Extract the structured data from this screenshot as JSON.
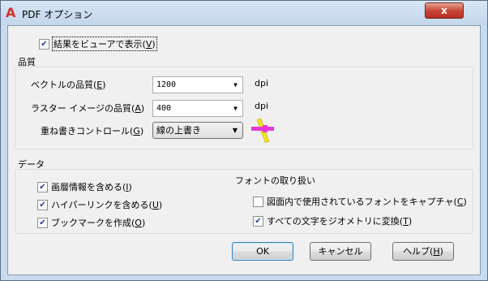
{
  "window": {
    "title": "PDF オプション",
    "app_icon": "autocad-a-icon",
    "close_label": "x"
  },
  "view_result": {
    "label": "結果をビューアで表示(",
    "key": "V",
    "suffix": ")",
    "checked": true
  },
  "quality": {
    "heading": "品質",
    "vector": {
      "label": "ベクトルの品質(",
      "key": "E",
      "suffix": ")",
      "value": "1200",
      "unit": "dpi"
    },
    "raster": {
      "label": "ラスター イメージの品質(",
      "key": "A",
      "suffix": ")",
      "value": "400",
      "unit": "dpi"
    },
    "overlay": {
      "label": "重ね書きコントロール(",
      "key": "G",
      "suffix": ")",
      "value": "線の上書き",
      "icon": "line-overwrite-icon"
    }
  },
  "data_section": {
    "heading": "データ",
    "layers": {
      "label": "画層情報を含める(",
      "key": "I",
      "suffix": ")",
      "checked": true
    },
    "hyperlinks": {
      "label": "ハイパーリンクを含める(",
      "key": "U",
      "suffix": ")",
      "checked": true
    },
    "bookmarks": {
      "label": "ブックマークを作成(",
      "key": "O",
      "suffix": ")",
      "checked": true
    }
  },
  "fonts": {
    "heading": "フォントの取り扱い",
    "capture": {
      "label": "図面内で使用されているフォントをキャプチャ(",
      "key": "C",
      "suffix": ")",
      "checked": false
    },
    "geometry": {
      "label": "すべての文字をジオメトリに変換(",
      "key": "T",
      "suffix": ")",
      "checked": true
    }
  },
  "buttons": {
    "ok": "OK",
    "cancel": "キャンセル",
    "help": {
      "label": "ヘルプ(",
      "key": "H",
      "suffix": ")"
    }
  },
  "colors": {
    "titlebar": "#c9dcef",
    "close": "#c9463a",
    "checkmark": "#233c9c",
    "icon_magenta": "#e83ad9",
    "icon_yellow": "#f2e21a"
  }
}
